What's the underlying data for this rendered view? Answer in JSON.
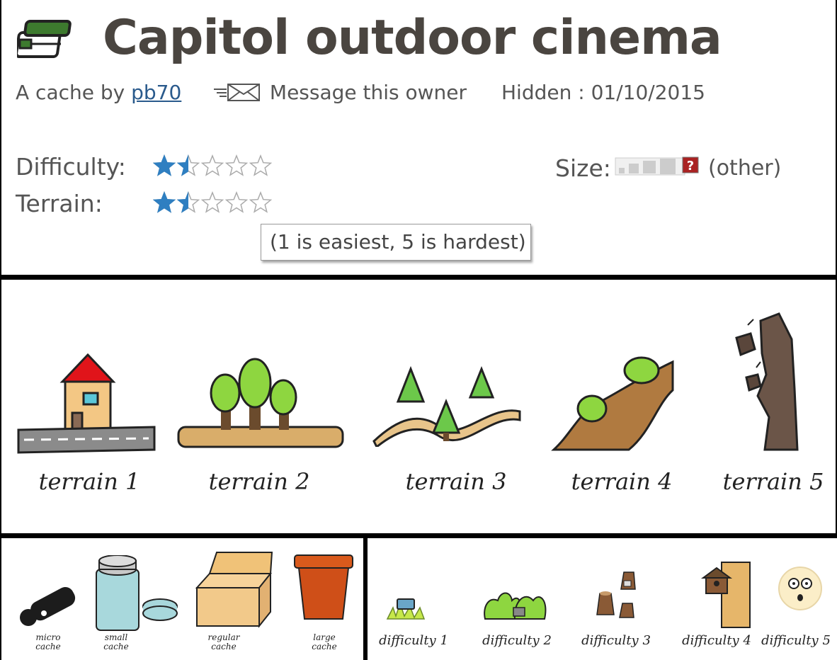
{
  "header": {
    "title": "Capitol outdoor cinema",
    "by_prefix": "A cache by ",
    "owner": "pb70",
    "message_link": "Message this owner",
    "hidden": "Hidden : 01/10/2015",
    "difficulty_label": "Difficulty:",
    "terrain_label": "Terrain:",
    "difficulty_rating": 1.5,
    "terrain_rating": 1.5,
    "size_label": "Size:",
    "size_value": "(other)",
    "tooltip": "(1 is easiest, 5 is hardest)",
    "icons": {
      "cache_type": "traditional-cache-container-icon",
      "message": "envelope-icon",
      "size_unknown": "question-mark-icon"
    },
    "colors": {
      "title": "#4a4540",
      "link": "#2a5a8c",
      "star": "#2f7fc1"
    }
  },
  "terrain_legend": [
    {
      "label": "terrain 1",
      "icon": "house-road-icon"
    },
    {
      "label": "terrain 2",
      "icon": "trees-flat-icon"
    },
    {
      "label": "terrain 3",
      "icon": "hilly-pines-icon"
    },
    {
      "label": "terrain 4",
      "icon": "steep-slope-icon"
    },
    {
      "label": "terrain 5",
      "icon": "cliff-rocks-icon"
    }
  ],
  "size_legend": [
    {
      "line1": "micro",
      "line2": "cache",
      "icon": "micro-container-icon"
    },
    {
      "line1": "small",
      "line2": "cache",
      "icon": "jar-container-icon"
    },
    {
      "line1": "regular",
      "line2": "cache",
      "icon": "box-container-icon"
    },
    {
      "line1": "large",
      "line2": "cache",
      "icon": "bucket-container-icon"
    }
  ],
  "difficulty_legend": [
    {
      "label": "difficulty 1",
      "icon": "container-in-grass-icon"
    },
    {
      "label": "difficulty 2",
      "icon": "container-in-bushes-icon"
    },
    {
      "label": "difficulty 3",
      "icon": "stumps-icon"
    },
    {
      "label": "difficulty 4",
      "icon": "birdhouse-on-tree-icon"
    },
    {
      "label": "difficulty 5",
      "icon": "puzzled-face-icon"
    }
  ]
}
